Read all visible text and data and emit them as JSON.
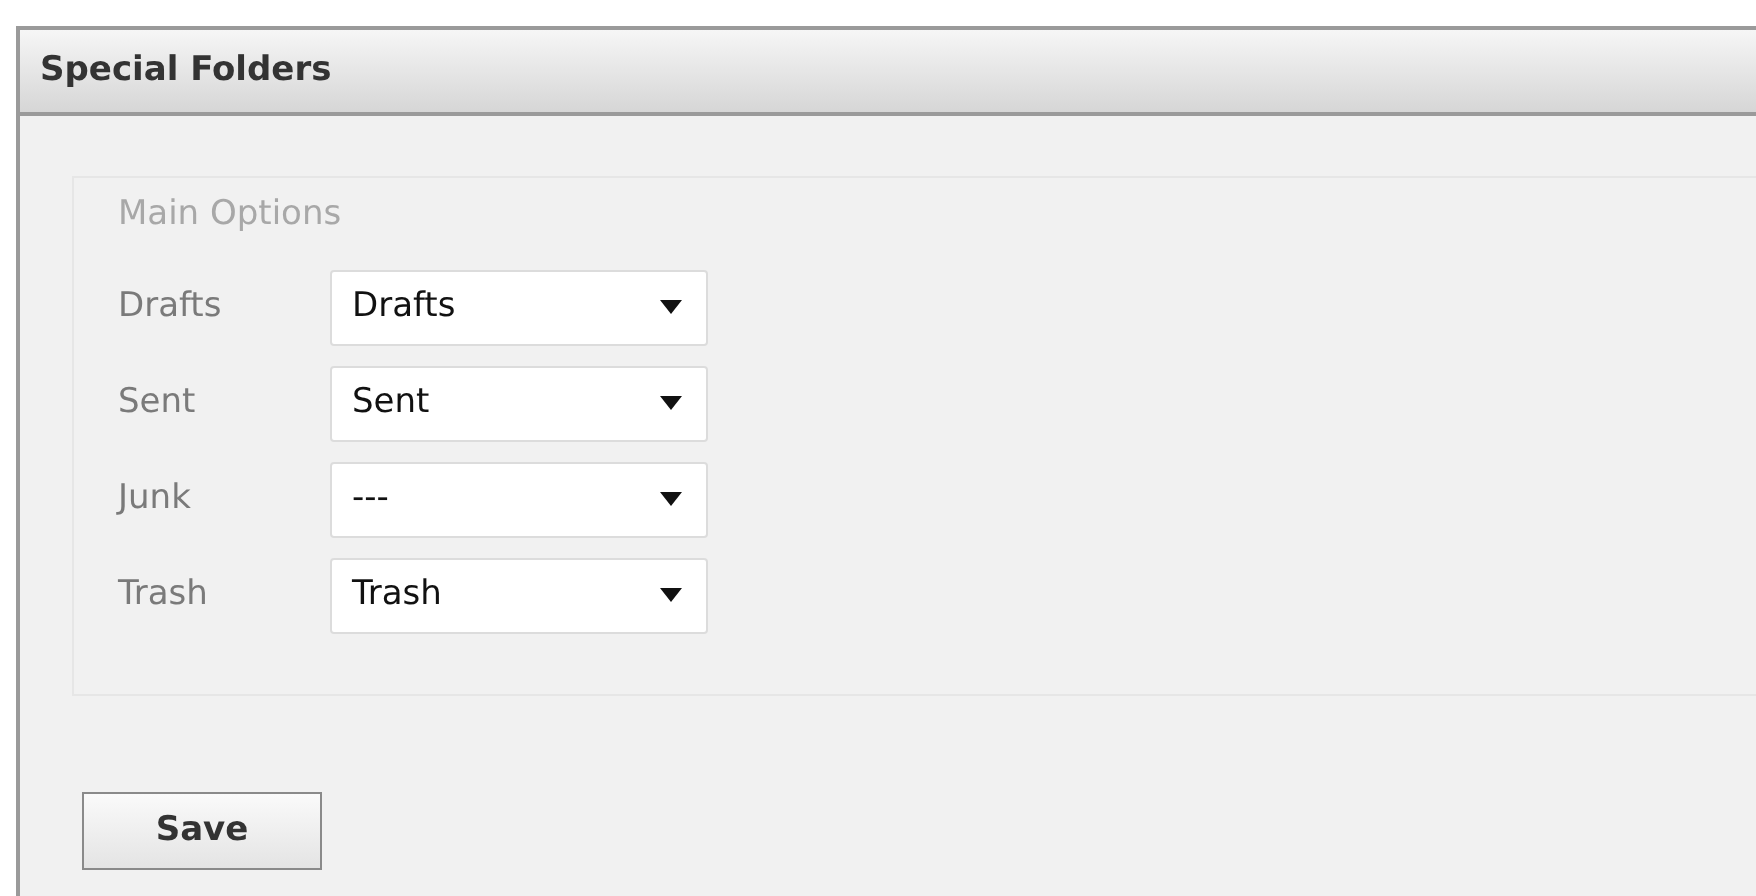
{
  "panel": {
    "title": "Special Folders"
  },
  "fieldset": {
    "legend": "Main Options",
    "rows": [
      {
        "label": "Drafts",
        "value": "Drafts"
      },
      {
        "label": "Sent",
        "value": "Sent"
      },
      {
        "label": "Junk",
        "value": "---"
      },
      {
        "label": "Trash",
        "value": "Trash"
      }
    ]
  },
  "buttons": [
    "Save"
  ]
}
